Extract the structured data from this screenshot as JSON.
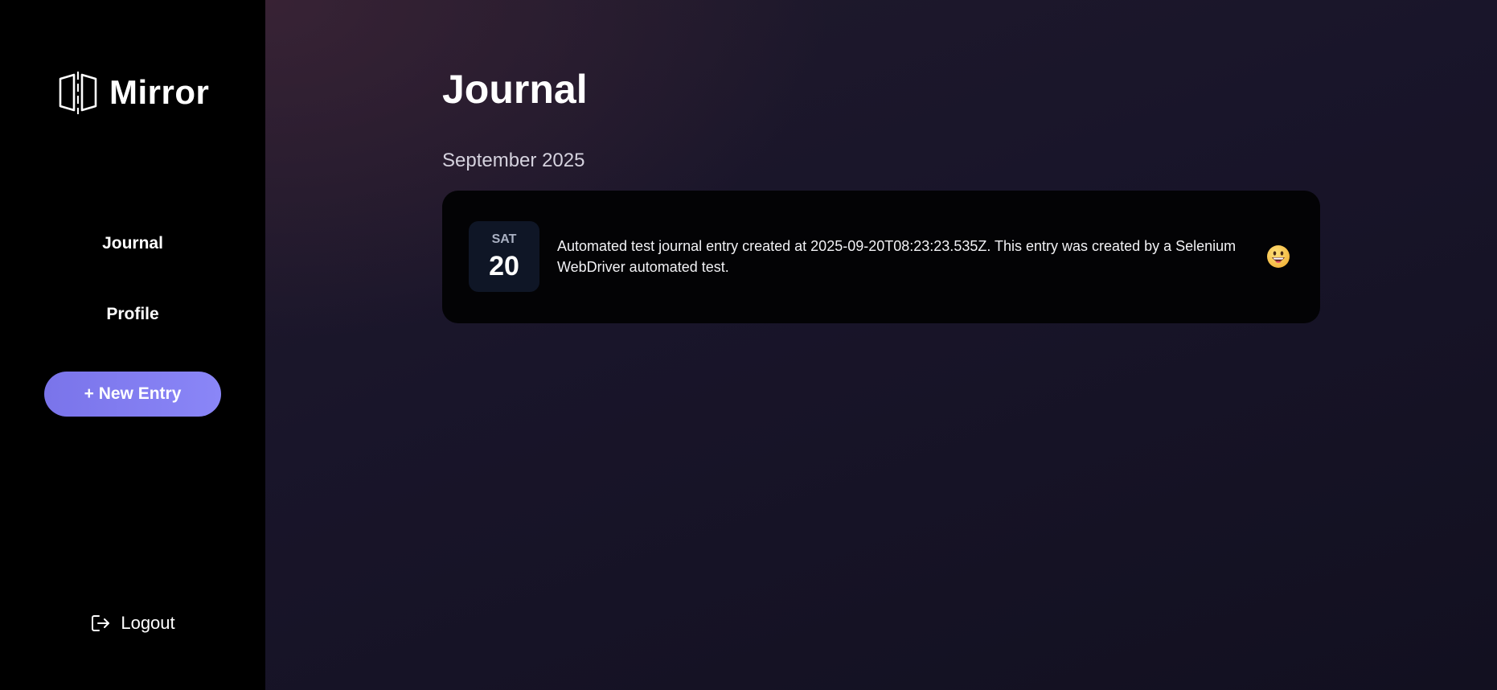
{
  "sidebar": {
    "brand": {
      "name": "Mirror",
      "icon": "mirror-icon"
    },
    "nav": [
      {
        "label": "Journal"
      },
      {
        "label": "Profile"
      }
    ],
    "new_entry_label": "+ New Entry",
    "logout": {
      "label": "Logout",
      "icon": "logout-icon"
    }
  },
  "main": {
    "title": "Journal",
    "groups": [
      {
        "month": "September 2025",
        "entries": [
          {
            "weekday": "SAT",
            "day": "20",
            "text": "Automated test journal entry created at 2025-09-20T08:23:23.535Z. This entry was created by a Selenium WebDriver automated test.",
            "mood_icon": "grinning-face-icon"
          }
        ]
      }
    ]
  },
  "colors": {
    "accent": "#7f7af2",
    "sidebar_bg": "#000000",
    "card_bg": "#030305",
    "date_badge_bg": "#0f1626"
  }
}
